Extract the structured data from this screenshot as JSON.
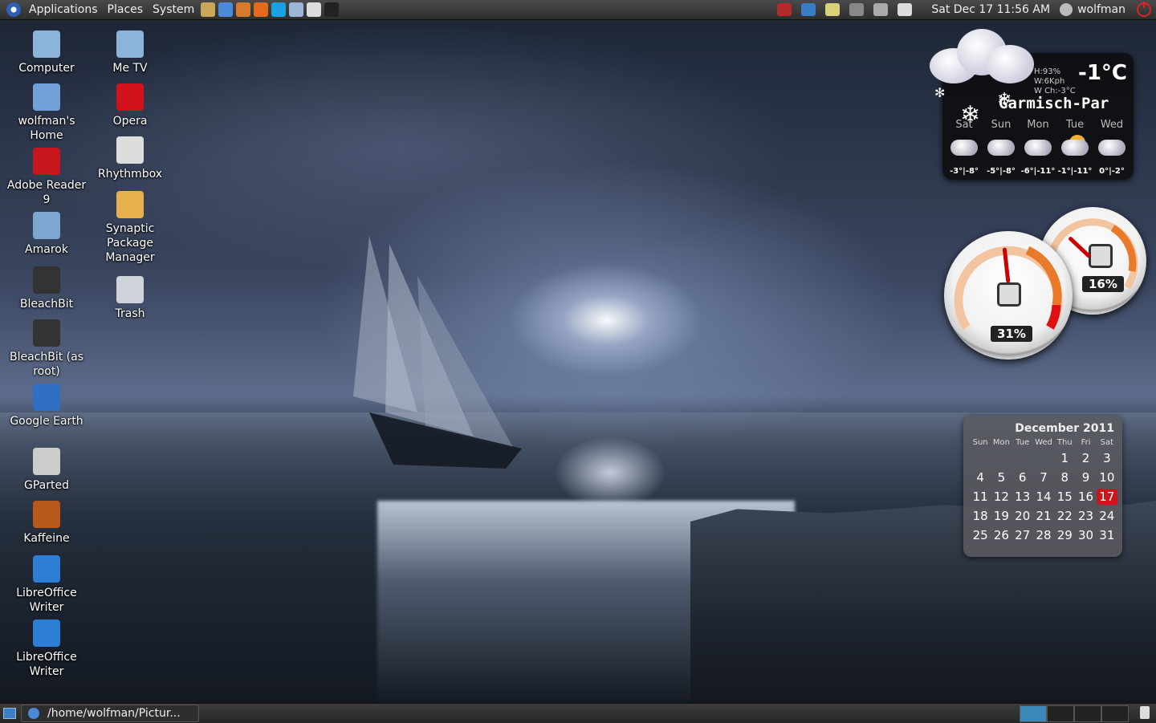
{
  "top_panel": {
    "menus": [
      "Applications",
      "Places",
      "System"
    ],
    "launchers": [
      {
        "name": "tools-icon",
        "color": "#c9a75a"
      },
      {
        "name": "browser-icon",
        "color": "#4a8ad8"
      },
      {
        "name": "office-icon",
        "color": "#d87a2b"
      },
      {
        "name": "firefox-icon",
        "color": "#e66a1e"
      },
      {
        "name": "skype-icon",
        "color": "#1aa1e3"
      },
      {
        "name": "files-icon",
        "color": "#9db5d8"
      },
      {
        "name": "notes-icon",
        "color": "#ddd"
      },
      {
        "name": "terminal-icon",
        "color": "#222"
      }
    ],
    "clock": "Sat Dec 17 11:56 AM",
    "username": "wolfman"
  },
  "desktop": {
    "col1": [
      {
        "label": "Computer",
        "icon": "computer-icon",
        "color": "#8cb4d8"
      },
      {
        "label": "wolfman's Home",
        "icon": "home-folder-icon",
        "color": "#6fa0d8"
      },
      {
        "label": "Adobe Reader 9",
        "icon": "adobe-reader-icon",
        "color": "#c8161d"
      },
      {
        "label": "Amarok",
        "icon": "amarok-icon",
        "color": "#7fa6d0"
      },
      {
        "label": "BleachBit",
        "icon": "bleachbit-icon",
        "color": "#333"
      },
      {
        "label": "BleachBit (as root)",
        "icon": "bleachbit-root-icon",
        "color": "#333"
      },
      {
        "label": "Google Earth",
        "icon": "google-earth-icon",
        "color": "#2f6fc4"
      },
      {
        "label": "GParted",
        "icon": "gparted-icon",
        "color": "#ccc"
      },
      {
        "label": "Kaffeine",
        "icon": "kaffeine-icon",
        "color": "#b9581b"
      },
      {
        "label": "LibreOffice Writer",
        "icon": "libreoffice-writer-icon",
        "color": "#2d7fd6"
      },
      {
        "label": "LibreOffice Writer",
        "icon": "libreoffice-writer-icon",
        "color": "#2d7fd6"
      }
    ],
    "col2": [
      {
        "label": "Me TV",
        "icon": "metv-icon",
        "color": "#8cb4d8"
      },
      {
        "label": "Opera",
        "icon": "opera-icon",
        "color": "#d31118"
      },
      {
        "label": "Rhythmbox",
        "icon": "rhythmbox-icon",
        "color": "#ddd"
      },
      {
        "label": "Synaptic Package Manager",
        "icon": "synaptic-icon",
        "color": "#e6b04a"
      },
      {
        "label": "Trash",
        "icon": "trash-icon",
        "color": "#cfd4da"
      }
    ]
  },
  "weather": {
    "humidity": "H:93%",
    "wind": "W:6Kph",
    "wind_chill": "W Ch:-3°C",
    "temperature": "-1°C",
    "city": "Garmisch-Par",
    "days": [
      "Sat",
      "Sun",
      "Mon",
      "Tue",
      "Wed"
    ],
    "ranges": [
      "-3°|-8°",
      "-5°|-8°",
      "-6°|-11°",
      "-1°|-11°",
      "0°|-2°"
    ],
    "forecast_types": [
      "snow",
      "snow",
      "snow",
      "sun",
      "snow"
    ]
  },
  "gauges": {
    "cpu_percent": 31,
    "cpu_label": "31%",
    "mem_percent": 16,
    "mem_label": "16%"
  },
  "calendar": {
    "title": "December 2011",
    "weekdays": [
      "Sun",
      "Mon",
      "Tue",
      "Wed",
      "Thu",
      "Fri",
      "Sat"
    ],
    "weeks": [
      [
        "",
        "",
        "",
        "",
        "1",
        "2",
        "3"
      ],
      [
        "4",
        "5",
        "6",
        "7",
        "8",
        "9",
        "10"
      ],
      [
        "11",
        "12",
        "13",
        "14",
        "15",
        "16",
        "17"
      ],
      [
        "18",
        "19",
        "20",
        "21",
        "22",
        "23",
        "24"
      ],
      [
        "25",
        "26",
        "27",
        "28",
        "29",
        "30",
        "31"
      ]
    ],
    "today": "17"
  },
  "bottom_panel": {
    "task_label": "/home/wolfman/Pictur..."
  }
}
